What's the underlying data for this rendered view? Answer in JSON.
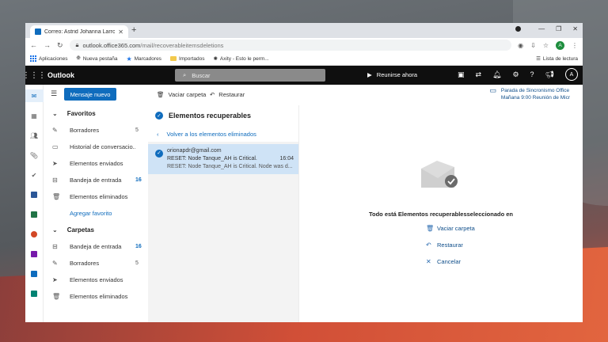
{
  "browser": {
    "tab_title": "Correo: Astrid Johanna Larrota C",
    "url_domain": "outlook.office365.com",
    "url_path": "/mail/recoverableitemsdeletions",
    "profile_initial": "A",
    "bookmarks": [
      "Aplicaciones",
      "Nueva pestaña",
      "Marcadores",
      "Importados",
      "Axity - Esto le perm..."
    ],
    "reading_list": "Lista de lectura"
  },
  "outlook": {
    "brand": "Outlook",
    "search_placeholder": "Buscar",
    "meet_now": "Reunirse ahora",
    "avatar_initial": "A",
    "new_message": "Mensaje nuevo",
    "empty_folder": "Vaciar carpeta",
    "restore": "Restaurar",
    "sync_title": "Parada de Sincronismo Office",
    "sync_time": "Mañana 9:00 Reunión de Micr"
  },
  "folders": {
    "favorites_title": "Favoritos",
    "favorites": [
      {
        "label": "Borradores",
        "count": "5"
      },
      {
        "label": "Historial de conversacio...",
        "count": ""
      },
      {
        "label": "Elementos enviados",
        "count": ""
      },
      {
        "label": "Bandeja de entrada",
        "count": "16"
      },
      {
        "label": "Elementos eliminados",
        "count": ""
      }
    ],
    "add_favorite": "Agregar favorito",
    "folders_title": "Carpetas",
    "folder_items": [
      {
        "label": "Bandeja de entrada",
        "count": "16"
      },
      {
        "label": "Borradores",
        "count": "5"
      },
      {
        "label": "Elementos enviados",
        "count": ""
      },
      {
        "label": "Elementos eliminados",
        "count": ""
      }
    ]
  },
  "message_list": {
    "title": "Elementos recuperables",
    "back_link": "Volver a los elementos eliminados",
    "message": {
      "sender": "orionapdr@gmail.com",
      "subject": "RESET: Node Tanque_AH is Critical.",
      "time": "16:04",
      "preview": "RESET: Node Tanque_AH is Critical. Node was d..."
    }
  },
  "reading_pane": {
    "selected_text": "Todo está Elementos recuperablesseleccionado en",
    "actions": [
      "Vaciar carpeta",
      "Restaurar",
      "Cancelar"
    ]
  }
}
